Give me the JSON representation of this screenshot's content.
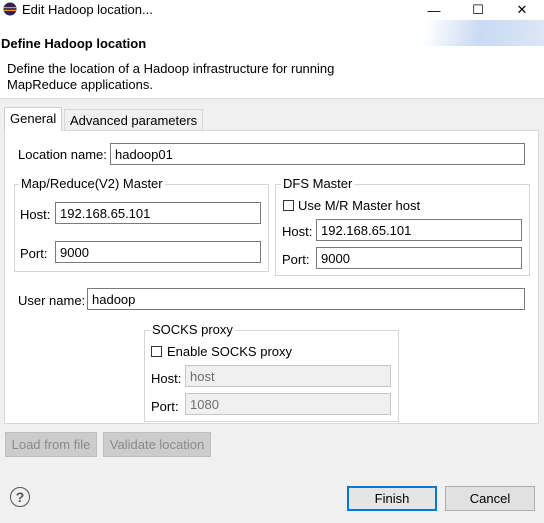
{
  "window": {
    "title": "Edit Hadoop location...",
    "minimize_glyph": "—",
    "maximize_glyph": "☐",
    "close_glyph": "✕"
  },
  "header": {
    "title": "Define Hadoop location",
    "description_line1": "Define the location of a Hadoop infrastructure for running",
    "description_line2": "MapReduce applications."
  },
  "tabs": [
    {
      "label": "General",
      "selected": true
    },
    {
      "label": "Advanced parameters",
      "selected": false
    }
  ],
  "general": {
    "location_name_label": "Location name:",
    "location_name_value": "hadoop01",
    "mapreduce_group": {
      "title": "Map/Reduce(V2) Master",
      "host_label": "Host:",
      "host_value": "192.168.65.101",
      "port_label": "Port:",
      "port_value": "9000"
    },
    "dfs_group": {
      "title": "DFS Master",
      "use_mr_label": "Use M/R Master host",
      "use_mr_checked": false,
      "host_label": "Host:",
      "host_value": "192.168.65.101",
      "port_label": "Port:",
      "port_value": "9000"
    },
    "user_name_label": "User name:",
    "user_name_value": "hadoop",
    "socks_group": {
      "title": "SOCKS proxy",
      "enable_label": "Enable SOCKS proxy",
      "enable_checked": false,
      "host_label": "Host:",
      "host_value": "host",
      "port_label": "Port:",
      "port_value": "1080"
    }
  },
  "actions": {
    "load_label": "Load from file",
    "validate_label": "Validate location"
  },
  "footer": {
    "help_glyph": "?",
    "finish_label": "Finish",
    "cancel_label": "Cancel"
  },
  "colors": {
    "accent": "#0078d7",
    "dialog_bg": "#f0f0f0",
    "panel_bg": "#ffffff"
  },
  "icons": [
    "eclipse-app-icon",
    "help-icon"
  ]
}
